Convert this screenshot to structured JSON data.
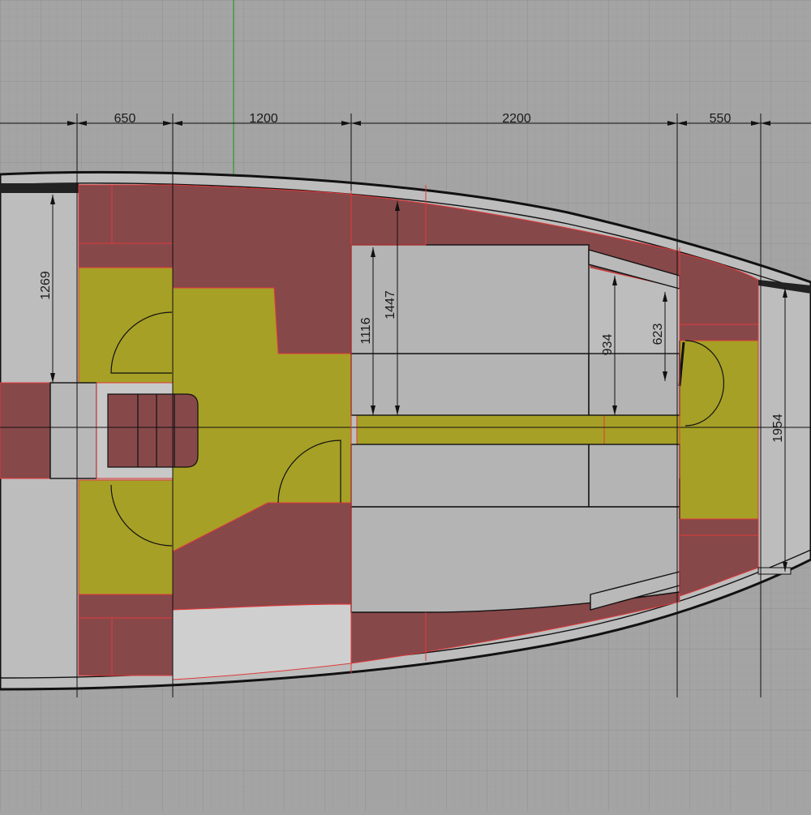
{
  "dimensions": {
    "d650": "650",
    "d1200": "1200",
    "d2200": "2200",
    "d550": "550",
    "d1269": "1269",
    "d1116": "1116",
    "d1447": "1447",
    "d934": "934",
    "d623": "623",
    "d1954": "1954"
  },
  "colors": {
    "background": "#a4a4a4",
    "storage": "#87484a",
    "floor": "#a6a026",
    "hull": "#b9b9b9",
    "berth": "#b4b4b4",
    "accent_line": "#e03a3a",
    "axis_green": "#2a9a2a"
  }
}
